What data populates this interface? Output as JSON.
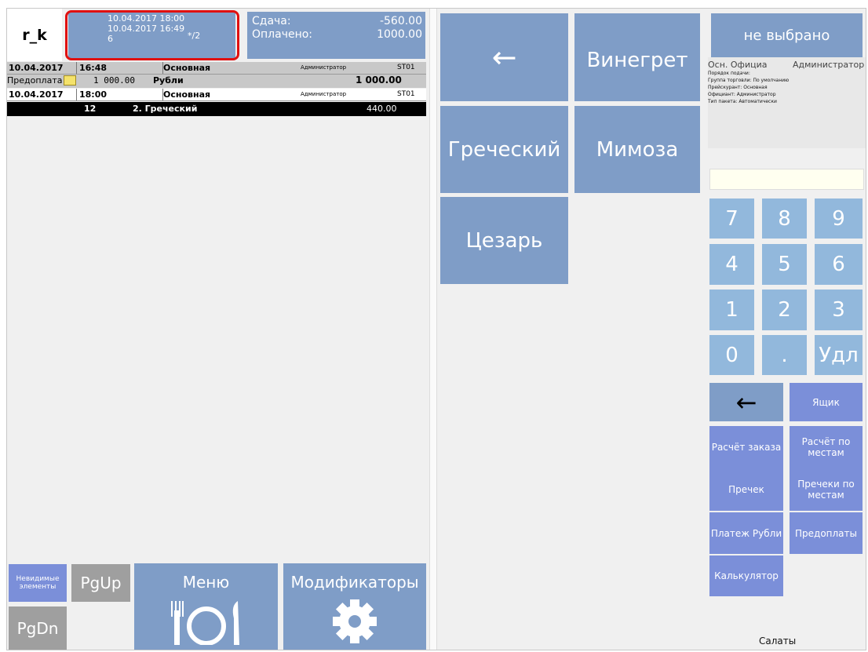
{
  "header": {
    "logo": "r_k",
    "date1": "10.04.2017 18:00",
    "date2": "10.04.2017 16:49",
    "guests": "6",
    "seats": "*/2",
    "change_label": "Сдача:",
    "change_value": "-560.00",
    "paid_label": "Оплачено:",
    "paid_value": "1000.00"
  },
  "order": {
    "rows": [
      {
        "date": "10.04.2017",
        "time": "16:48",
        "type": "Основная",
        "waiter": "Администратор",
        "station": "ST01"
      },
      {
        "prepay_label": "Предоплата",
        "amount": "1 000.00",
        "currency": "Рубли",
        "total": "1 000.00"
      },
      {
        "date": "10.04.2017",
        "time": "18:00",
        "type": "Основная",
        "waiter": "Администратор",
        "station": "ST01"
      },
      {
        "qty": "12",
        "name": "2.  Греческий",
        "price": "440.00"
      }
    ]
  },
  "bottom": {
    "invisible": "Невидимые элементы",
    "pgup": "PgUp",
    "pgdn": "PgDn",
    "menu": "Меню",
    "modifiers": "Модификаторы"
  },
  "menu_items": {
    "back": "←",
    "vinegret": "Винегрет",
    "grecheskiy": "Греческий",
    "mimoza": "Мимоза",
    "tsezar": "Цезарь"
  },
  "right": {
    "not_selected": "не выбрано",
    "info_title": "Осн. Официа",
    "info_admin": "Администратор",
    "info_lines": [
      "Порядок подачи:",
      "Группа торговли: По умолчанию",
      "Прейскурант: Основная",
      "Официант: Администратор",
      "Тип пакета: Автоматически"
    ],
    "keys": [
      "7",
      "8",
      "9",
      "4",
      "5",
      "6",
      "1",
      "2",
      "3",
      "0",
      ".",
      "Удл"
    ],
    "back": "←",
    "drawer": "Ящик",
    "calc_order": "Расчёт заказа",
    "calc_seats": "Расчёт по местам",
    "precheck": "Пречек",
    "precheck_seats": "Пречеки по местам",
    "payment": "Платеж Рубли",
    "prepayments": "Предоплаты",
    "calculator": "Калькулятор",
    "category": "Салаты"
  },
  "colors": {
    "highlight_border": "#e01010",
    "button_blue": "#7f9dc7",
    "button_purple": "#7b8fd9",
    "numpad": "#92b8dc"
  }
}
